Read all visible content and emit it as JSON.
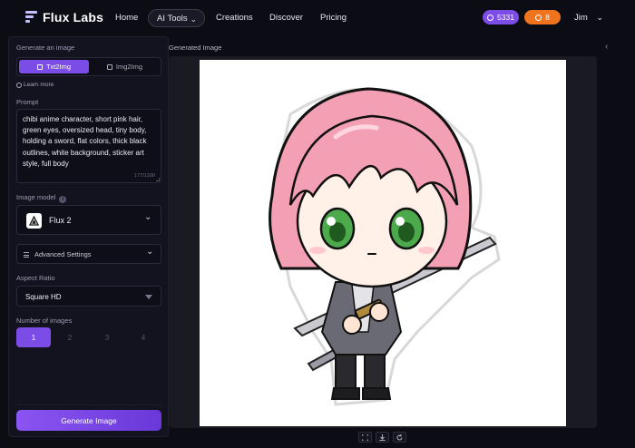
{
  "brand": {
    "name": "Flux Labs"
  },
  "nav": {
    "home": "Home",
    "ai_tools": "AI Tools",
    "creations": "Creations",
    "discover": "Discover",
    "pricing": "Pricing"
  },
  "account": {
    "credits": "5331",
    "coins": "8",
    "user": "Jim"
  },
  "left": {
    "section_title": "Generate an image",
    "modes": [
      "Txt2Img",
      "Img2Img"
    ],
    "active_mode": "Txt2Img",
    "learn_more": "Learn more",
    "prompt_label": "Prompt",
    "prompt_value": "chibi anime character, short pink hair, green eyes, oversized head, tiny body, holding a sword, flat colors, thick black outlines, white background, sticker art style, full body",
    "prompt_count": "177/1200",
    "model_label": "Image model",
    "model_name": "Flux 2",
    "advanced_label": "Advanced Settings",
    "aspect_label": "Aspect Ratio",
    "aspect_value": "Square HD",
    "num_label": "Number of images",
    "num_options": [
      "1",
      "2",
      "3",
      "4"
    ],
    "num_selected": "1",
    "generate_label": "Generate Image"
  },
  "right": {
    "title": "Generated Image"
  },
  "colors": {
    "accent": "#7c4ce6",
    "coins": "#f0741e",
    "background": "#0c0c14",
    "panel": "#131320"
  },
  "icons": [
    "flux-labs-logo-icon",
    "chevron-down-icon",
    "credits-icon",
    "coin-icon",
    "text-icon",
    "image-icon",
    "info-icon",
    "triangle-model-icon",
    "sliders-icon",
    "caret-down-icon",
    "chevron-left-icon",
    "fullscreen-icon",
    "download-icon",
    "regenerate-icon"
  ]
}
